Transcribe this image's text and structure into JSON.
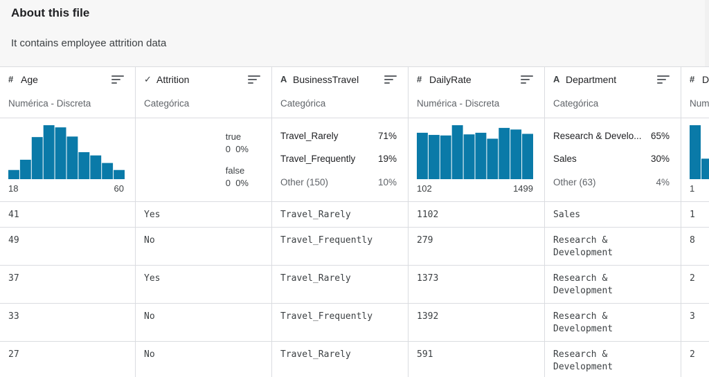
{
  "about": {
    "title": "About this file",
    "description": "It contains employee attrition data"
  },
  "columns": [
    {
      "icon": "#",
      "icon_name": "hash-icon",
      "name": "Age",
      "type": "Numérica - Discreta",
      "summary": {
        "kind": "histogram",
        "min": "18",
        "max": "60",
        "bins": [
          0.17,
          0.36,
          0.78,
          1.0,
          0.96,
          0.79,
          0.5,
          0.44,
          0.3,
          0.17
        ]
      }
    },
    {
      "icon": "✓",
      "icon_name": "check-icon",
      "name": "Attrition",
      "type": "Categórica",
      "summary": {
        "kind": "boolean",
        "true_label": "true",
        "true_value": "0  0%",
        "false_label": "false",
        "false_value": "0  0%"
      }
    },
    {
      "icon": "A",
      "icon_name": "text-type-icon",
      "name": "BusinessTravel",
      "type": "Categórica",
      "summary": {
        "kind": "categories",
        "items": [
          {
            "label": "Travel_Rarely",
            "pct": "71%"
          },
          {
            "label": "Travel_Frequently",
            "pct": "19%"
          }
        ],
        "other": {
          "label": "Other (150)",
          "pct": "10%"
        }
      }
    },
    {
      "icon": "#",
      "icon_name": "hash-icon",
      "name": "DailyRate",
      "type": "Numérica - Discreta",
      "summary": {
        "kind": "histogram",
        "min": "102",
        "max": "1499",
        "bins": [
          0.86,
          0.82,
          0.81,
          1.0,
          0.83,
          0.86,
          0.75,
          0.95,
          0.92,
          0.84
        ]
      }
    },
    {
      "icon": "A",
      "icon_name": "text-type-icon",
      "name": "Department",
      "type": "Categórica",
      "summary": {
        "kind": "categories",
        "items": [
          {
            "label": "Research & Develo...",
            "pct": "65%"
          },
          {
            "label": "Sales",
            "pct": "30%"
          }
        ],
        "other": {
          "label": "Other (63)",
          "pct": "4%"
        }
      }
    },
    {
      "icon": "#",
      "icon_name": "hash-icon",
      "name": "D",
      "type": "Num",
      "summary": {
        "kind": "histogram",
        "min": "1",
        "max": "",
        "bins": [
          1.0,
          0.38
        ]
      }
    }
  ],
  "rows": [
    [
      "41",
      "Yes",
      "Travel_Rarely",
      "1102",
      "Sales",
      "1"
    ],
    [
      "49",
      "No",
      "Travel_Frequently",
      "279",
      "Research & Development",
      "8"
    ],
    [
      "37",
      "Yes",
      "Travel_Rarely",
      "1373",
      "Research & Development",
      "2"
    ],
    [
      "33",
      "No",
      "Travel_Frequently",
      "1392",
      "Research & Development",
      "3"
    ],
    [
      "27",
      "No",
      "Travel_Rarely",
      "591",
      "Research & Development",
      "2"
    ]
  ],
  "colors": {
    "bar": "#0a7aa8",
    "border": "#dadce0",
    "about_bg": "#f7f7f7"
  }
}
